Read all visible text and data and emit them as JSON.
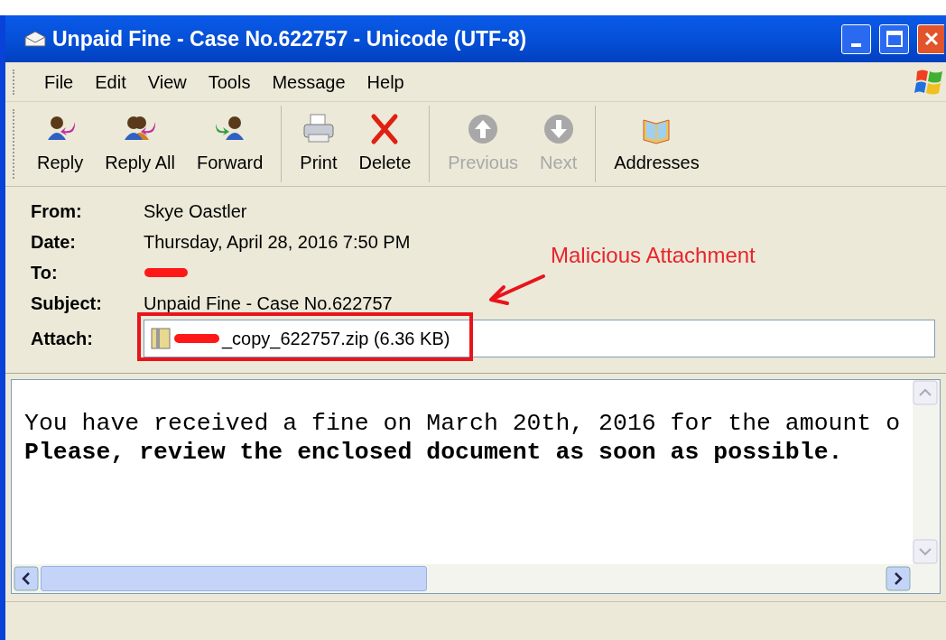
{
  "window": {
    "title": "Unpaid Fine - Case No.622757 - Unicode (UTF-8)"
  },
  "menu": [
    "File",
    "Edit",
    "View",
    "Tools",
    "Message",
    "Help"
  ],
  "toolbar": [
    [
      {
        "kind": "reply",
        "label": "Reply",
        "disabled": false
      },
      {
        "kind": "reply-all",
        "label": "Reply All",
        "disabled": false
      },
      {
        "kind": "forward",
        "label": "Forward",
        "disabled": false
      }
    ],
    [
      {
        "kind": "print",
        "label": "Print",
        "disabled": false
      },
      {
        "kind": "delete",
        "label": "Delete",
        "disabled": false
      }
    ],
    [
      {
        "kind": "previous",
        "label": "Previous",
        "disabled": true
      },
      {
        "kind": "next",
        "label": "Next",
        "disabled": true
      }
    ],
    [
      {
        "kind": "addresses",
        "label": "Addresses",
        "disabled": false
      }
    ]
  ],
  "header": {
    "fields": [
      {
        "label": "From:",
        "value": "Skye Oastler",
        "redacted": false
      },
      {
        "label": "Date:",
        "value": "Thursday, April 28, 2016 7:50 PM",
        "redacted": false
      },
      {
        "label": "To:",
        "redacted": true
      },
      {
        "label": "Subject:",
        "value": "Unpaid Fine - Case No.622757",
        "redacted": false
      }
    ],
    "attachment": {
      "label": "Attach:",
      "file": "_copy_622757.zip (6.36 KB)"
    }
  },
  "annotation": {
    "text": "Malicious Attachment"
  },
  "body": {
    "lines": [
      {
        "text": "You have received a fine on March 20th, 2016 for the amount o",
        "bold": false
      },
      {
        "text": "Please, review the enclosed document as soon as possible.",
        "bold": true
      }
    ]
  }
}
